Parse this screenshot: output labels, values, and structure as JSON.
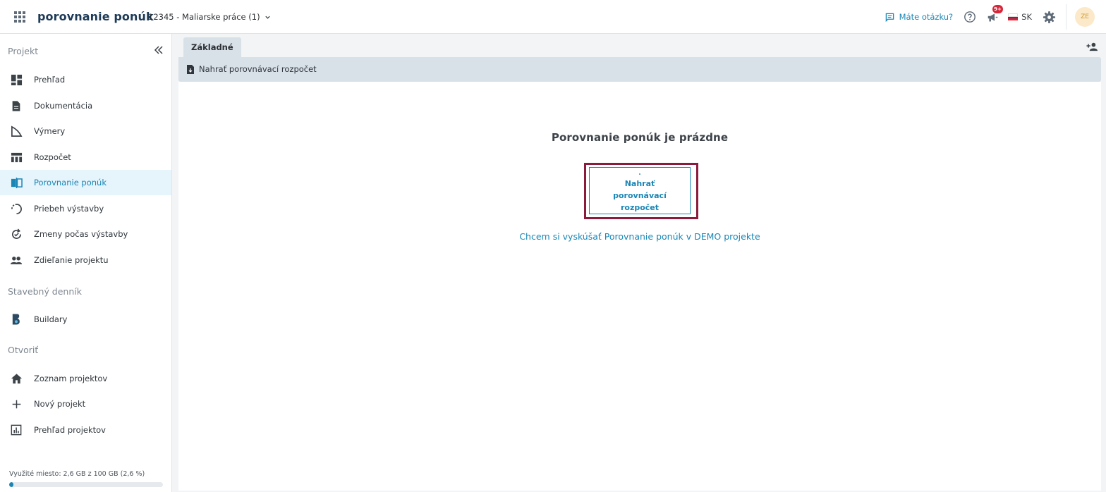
{
  "app": {
    "brand": "porovnanie ponúk",
    "project_selector": "12345 - Maliarske práce (1)"
  },
  "header": {
    "question_link": "Máte otázku?",
    "notification_badge": "9+",
    "language": "SK",
    "avatar_initials": "ZE",
    "icons": [
      "apps-grid-icon",
      "chat-icon",
      "help-icon",
      "megaphone-icon",
      "flag-sk-icon",
      "gear-icon"
    ]
  },
  "sidebar": {
    "section_project": "Projekt",
    "project_items": [
      {
        "label": "Prehľad",
        "icon": "dashboard-icon"
      },
      {
        "label": "Dokumentácia",
        "icon": "document-icon"
      },
      {
        "label": "Výmery",
        "icon": "measure-icon"
      },
      {
        "label": "Rozpočet",
        "icon": "budget-icon"
      },
      {
        "label": "Porovnanie ponúk",
        "icon": "compare-icon",
        "active": true
      },
      {
        "label": "Priebeh výstavby",
        "icon": "progress-icon"
      },
      {
        "label": "Zmeny počas výstavby",
        "icon": "changes-icon"
      },
      {
        "label": "Zdieľanie projektu",
        "icon": "people-icon"
      }
    ],
    "section_diary": "Stavebný denník",
    "diary_items": [
      {
        "label": "Buildary",
        "icon": "buildary-icon"
      }
    ],
    "section_open": "Otvoriť",
    "open_items": [
      {
        "label": "Zoznam projektov",
        "icon": "home-icon"
      },
      {
        "label": "Nový projekt",
        "icon": "plus-icon"
      },
      {
        "label": "Prehľad projektov",
        "icon": "chart-icon"
      }
    ],
    "storage_label": "Využité miesto: 2,6 GB z 100 GB (2,6 %)",
    "storage_percent": 2.6
  },
  "main": {
    "tab_label": "Základné",
    "toolbar_upload": "Nahrať porovnávací rozpočet",
    "empty_title": "Porovnanie ponúk je prázdne",
    "upload_card_label": "Nahrať porovnávací rozpočet",
    "demo_link": "Chcem si vyskúšať Porovnanie ponúk v DEMO projekte"
  },
  "colors": {
    "accent": "#1a86b6",
    "brand_text": "#1d3a57",
    "active_bg": "#e6f4fb",
    "highlight_border": "#8c1a3d",
    "badge": "#d6273a"
  }
}
